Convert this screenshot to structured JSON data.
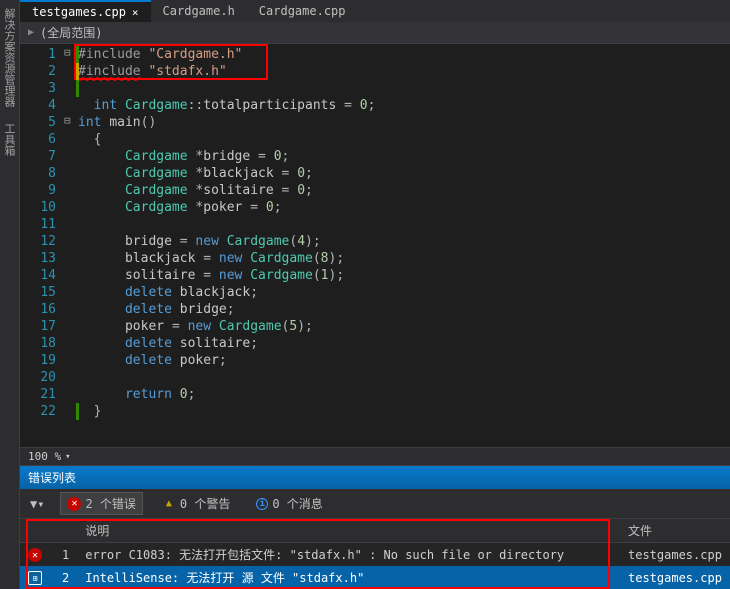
{
  "sidebar": {
    "tab1": "解决方案资源管理器",
    "tab2": "工具箱"
  },
  "tabs": [
    {
      "label": "testgames.cpp",
      "active": true,
      "close": "×"
    },
    {
      "label": "Cardgame.h",
      "active": false
    },
    {
      "label": "Cardgame.cpp",
      "active": false
    }
  ],
  "scope": {
    "label": "(全局范围)"
  },
  "zoom": {
    "level": "100 %"
  },
  "code": {
    "lines": [
      {
        "n": 1,
        "fold": "⊟",
        "bar": "green",
        "tokens": [
          [
            "pre",
            "#include"
          ],
          [
            "",
            " "
          ],
          [
            "str",
            "\"Cardgame.h\""
          ]
        ]
      },
      {
        "n": 2,
        "fold": "",
        "bar": "yellow",
        "tokens": [
          [
            "pre squiggle",
            "#include"
          ],
          [
            "",
            " "
          ],
          [
            "str",
            "\"stdafx.h\""
          ]
        ]
      },
      {
        "n": 3,
        "fold": "",
        "bar": "green",
        "tokens": []
      },
      {
        "n": 4,
        "fold": "",
        "bar": "",
        "tokens": [
          [
            "",
            "  "
          ],
          [
            "kw",
            "int"
          ],
          [
            "",
            " "
          ],
          [
            "type",
            "Cardgame"
          ],
          [
            "op",
            "::"
          ],
          [
            "ident",
            "totalparticipants"
          ],
          [
            "",
            " "
          ],
          [
            "op",
            "="
          ],
          [
            "",
            " "
          ],
          [
            "num",
            "0"
          ],
          [
            "op",
            ";"
          ]
        ]
      },
      {
        "n": 5,
        "fold": "⊟",
        "bar": "",
        "tokens": [
          [
            "kw",
            "int"
          ],
          [
            "",
            " "
          ],
          [
            "ident",
            "main"
          ],
          [
            "op",
            "()"
          ]
        ]
      },
      {
        "n": 6,
        "fold": "",
        "bar": "",
        "tokens": [
          [
            "",
            "  "
          ],
          [
            "op",
            "{"
          ]
        ]
      },
      {
        "n": 7,
        "fold": "",
        "bar": "",
        "tokens": [
          [
            "",
            "      "
          ],
          [
            "type",
            "Cardgame"
          ],
          [
            "",
            " "
          ],
          [
            "op",
            "*"
          ],
          [
            "ident",
            "bridge"
          ],
          [
            "",
            " "
          ],
          [
            "op",
            "="
          ],
          [
            "",
            " "
          ],
          [
            "num",
            "0"
          ],
          [
            "op",
            ";"
          ]
        ]
      },
      {
        "n": 8,
        "fold": "",
        "bar": "",
        "tokens": [
          [
            "",
            "      "
          ],
          [
            "type",
            "Cardgame"
          ],
          [
            "",
            " "
          ],
          [
            "op",
            "*"
          ],
          [
            "ident",
            "blackjack"
          ],
          [
            "",
            " "
          ],
          [
            "op",
            "="
          ],
          [
            "",
            " "
          ],
          [
            "num",
            "0"
          ],
          [
            "op",
            ";"
          ]
        ]
      },
      {
        "n": 9,
        "fold": "",
        "bar": "",
        "tokens": [
          [
            "",
            "      "
          ],
          [
            "type",
            "Cardgame"
          ],
          [
            "",
            " "
          ],
          [
            "op",
            "*"
          ],
          [
            "ident",
            "solitaire"
          ],
          [
            "",
            " "
          ],
          [
            "op",
            "="
          ],
          [
            "",
            " "
          ],
          [
            "num",
            "0"
          ],
          [
            "op",
            ";"
          ]
        ]
      },
      {
        "n": 10,
        "fold": "",
        "bar": "",
        "tokens": [
          [
            "",
            "      "
          ],
          [
            "type",
            "Cardgame"
          ],
          [
            "",
            " "
          ],
          [
            "op",
            "*"
          ],
          [
            "ident",
            "poker"
          ],
          [
            "",
            " "
          ],
          [
            "op",
            "="
          ],
          [
            "",
            " "
          ],
          [
            "num",
            "0"
          ],
          [
            "op",
            ";"
          ]
        ]
      },
      {
        "n": 11,
        "fold": "",
        "bar": "",
        "tokens": []
      },
      {
        "n": 12,
        "fold": "",
        "bar": "",
        "tokens": [
          [
            "",
            "      "
          ],
          [
            "ident",
            "bridge"
          ],
          [
            "",
            " "
          ],
          [
            "op",
            "="
          ],
          [
            "",
            " "
          ],
          [
            "kw",
            "new"
          ],
          [
            "",
            " "
          ],
          [
            "type",
            "Cardgame"
          ],
          [
            "op",
            "("
          ],
          [
            "num",
            "4"
          ],
          [
            "op",
            ");"
          ]
        ]
      },
      {
        "n": 13,
        "fold": "",
        "bar": "",
        "tokens": [
          [
            "",
            "      "
          ],
          [
            "ident",
            "blackjack"
          ],
          [
            "",
            " "
          ],
          [
            "op",
            "="
          ],
          [
            "",
            " "
          ],
          [
            "kw",
            "new"
          ],
          [
            "",
            " "
          ],
          [
            "type",
            "Cardgame"
          ],
          [
            "op",
            "("
          ],
          [
            "num",
            "8"
          ],
          [
            "op",
            ");"
          ]
        ]
      },
      {
        "n": 14,
        "fold": "",
        "bar": "",
        "tokens": [
          [
            "",
            "      "
          ],
          [
            "ident",
            "solitaire"
          ],
          [
            "",
            " "
          ],
          [
            "op",
            "="
          ],
          [
            "",
            " "
          ],
          [
            "kw",
            "new"
          ],
          [
            "",
            " "
          ],
          [
            "type",
            "Cardgame"
          ],
          [
            "op",
            "("
          ],
          [
            "num",
            "1"
          ],
          [
            "op",
            ");"
          ]
        ]
      },
      {
        "n": 15,
        "fold": "",
        "bar": "",
        "tokens": [
          [
            "",
            "      "
          ],
          [
            "kw",
            "delete"
          ],
          [
            "",
            " "
          ],
          [
            "ident",
            "blackjack"
          ],
          [
            "op",
            ";"
          ]
        ]
      },
      {
        "n": 16,
        "fold": "",
        "bar": "",
        "tokens": [
          [
            "",
            "      "
          ],
          [
            "kw",
            "delete"
          ],
          [
            "",
            " "
          ],
          [
            "ident",
            "bridge"
          ],
          [
            "op",
            ";"
          ]
        ]
      },
      {
        "n": 17,
        "fold": "",
        "bar": "",
        "tokens": [
          [
            "",
            "      "
          ],
          [
            "ident",
            "poker"
          ],
          [
            "",
            " "
          ],
          [
            "op",
            "="
          ],
          [
            "",
            " "
          ],
          [
            "kw",
            "new"
          ],
          [
            "",
            " "
          ],
          [
            "type",
            "Cardgame"
          ],
          [
            "op",
            "("
          ],
          [
            "num",
            "5"
          ],
          [
            "op",
            ");"
          ]
        ]
      },
      {
        "n": 18,
        "fold": "",
        "bar": "",
        "tokens": [
          [
            "",
            "      "
          ],
          [
            "kw",
            "delete"
          ],
          [
            "",
            " "
          ],
          [
            "ident",
            "solitaire"
          ],
          [
            "op",
            ";"
          ]
        ]
      },
      {
        "n": 19,
        "fold": "",
        "bar": "",
        "tokens": [
          [
            "",
            "      "
          ],
          [
            "kw",
            "delete"
          ],
          [
            "",
            " "
          ],
          [
            "ident",
            "poker"
          ],
          [
            "op",
            ";"
          ]
        ]
      },
      {
        "n": 20,
        "fold": "",
        "bar": "",
        "tokens": []
      },
      {
        "n": 21,
        "fold": "",
        "bar": "",
        "tokens": [
          [
            "",
            "      "
          ],
          [
            "kw",
            "return"
          ],
          [
            "",
            " "
          ],
          [
            "num",
            "0"
          ],
          [
            "op",
            ";"
          ]
        ]
      },
      {
        "n": 22,
        "fold": "",
        "bar": "green",
        "tokens": [
          [
            "",
            "  "
          ],
          [
            "op",
            "}"
          ]
        ]
      }
    ]
  },
  "errorPanel": {
    "title": "错误列表",
    "filters": {
      "errors": "2 个错误",
      "warnings": "0 个警告",
      "messages": "0 个消息"
    },
    "columns": {
      "desc": "说明",
      "file": "文件"
    },
    "rows": [
      {
        "idx": "1",
        "type": "error",
        "desc": "error C1083: 无法打开包括文件:  \"stdafx.h\" : No such file or directory",
        "file": "testgames.cpp",
        "selected": false
      },
      {
        "idx": "2",
        "type": "intellisense",
        "desc": "IntelliSense:  无法打开 源 文件 \"stdafx.h\"",
        "file": "testgames.cpp",
        "selected": true
      }
    ]
  }
}
